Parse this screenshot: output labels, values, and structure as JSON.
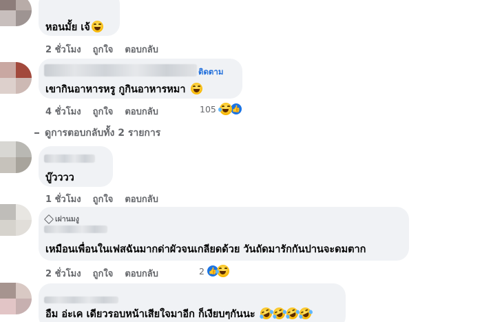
{
  "comments": [
    {
      "text": "หอนมั้ย เจ้",
      "emoji": "grin-sweat",
      "time": "2 ชั่วโมง",
      "like_label": "ถูกใจ",
      "reply_label": "ตอบกลับ"
    },
    {
      "follow_label": "ติดตาม",
      "text": "เขากินอาหารหรู กูกินอาหารหมา",
      "emoji": "grin-sweat",
      "time": "4 ชั่วโมง",
      "like_label": "ถูกใจ",
      "reply_label": "ตอบกลับ",
      "reaction_count": "105",
      "reactions": [
        "haha",
        "like"
      ]
    },
    {
      "text": "บู๊วววว",
      "time": "1 ชั่วโมง",
      "like_label": "ถูกใจ",
      "reply_label": "ตอบกลับ"
    },
    {
      "badge": "เผ่านมงู",
      "text": "เหมือนเพื่อนในเฟสฉันมากด่าผัวจนเกลียดด้วย วันถัดมารักกันปานจะดมตาก",
      "time": "2 ชั่วโมง",
      "like_label": "ถูกใจ",
      "reply_label": "ตอบกลับ",
      "reaction_count": "2",
      "reactions": [
        "like",
        "haha"
      ]
    },
    {
      "text": "อืม อ่ะเค เดียวรอบหน้าเสียใจมาอีก ก็เงียบๆกันนะ",
      "emojis": [
        "rofl",
        "rofl",
        "rofl",
        "rofl"
      ]
    }
  ],
  "view_replies": "ดูการตอบกลับทั้ง 2 รายการ",
  "colors": {
    "bubble": "#f0f2f5",
    "meta": "#65676b",
    "link": "#216fdb",
    "text": "#050505"
  }
}
